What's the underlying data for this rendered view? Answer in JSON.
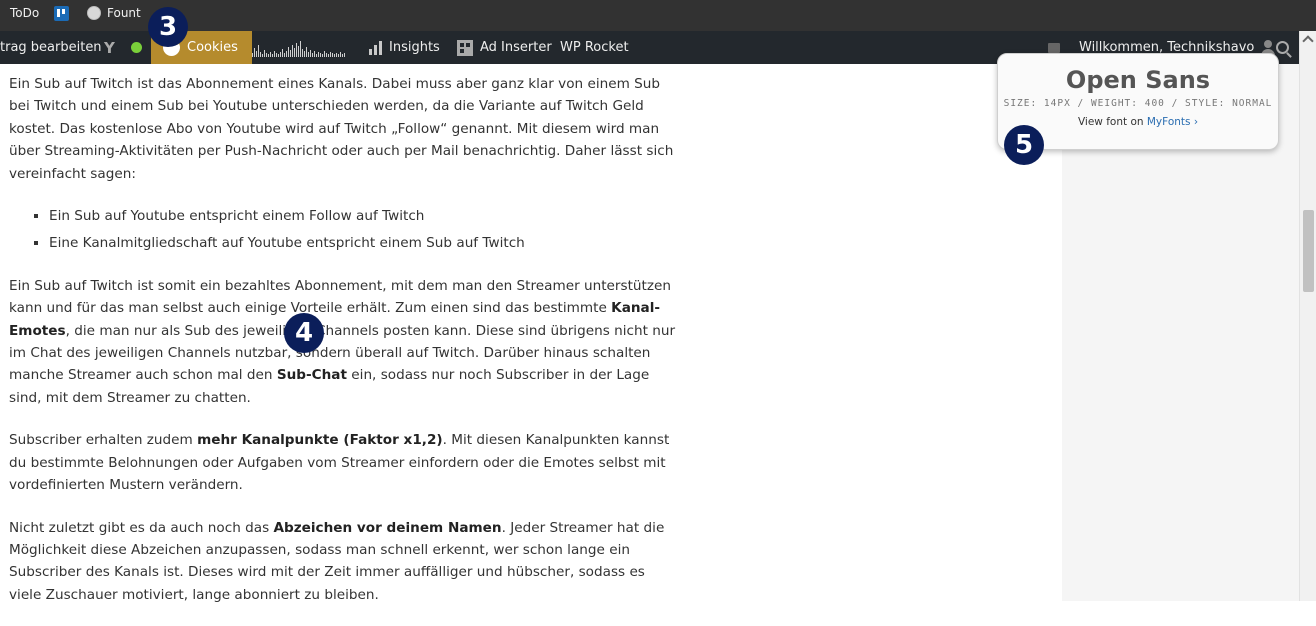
{
  "bookmarks": [
    {
      "label": "ToDo",
      "icon": "none"
    },
    {
      "label": "",
      "icon": "trello-icon"
    },
    {
      "label": "Fount",
      "icon": "globe-icon"
    }
  ],
  "adminbar": {
    "edit_post": "trag bearbeiten",
    "cookies": "Cookies",
    "insights": "Insights",
    "ad_inserter": "Ad Inserter",
    "wp_rocket": "WP Rocket",
    "welcome": "Willkommen, Technikshavo",
    "status_color": "#7ad03a",
    "cookies_color": "#b58b2d"
  },
  "article": {
    "p1": "Ein Sub auf Twitch ist das Abonnement eines Kanals. Dabei muss aber ganz klar von einem Sub bei Twitch und einem Sub bei Youtube unterschieden werden, da die Variante auf Twitch Geld kostet. Das kostenlose Abo von Youtube wird auf Twitch „Follow“ genannt. Mit diesem wird man über Streaming-Aktivitäten per Push-Nachricht oder auch per Mail benachrichtig. Daher lässt sich vereinfacht sagen:",
    "list": [
      "Ein Sub auf Youtube entspricht einem Follow auf Twitch",
      "Eine Kanalmitgliedschaft auf Youtube entspricht einem Sub auf Twitch"
    ],
    "p2_a": "Ein Sub auf Twitch ist somit ein bezahltes Abonnement, mit dem man den Streamer unterstützen kann und für das man selbst auch einige Vorteile erhält. Zum einen sind das bestimmte ",
    "p2_b1": "Kanal-Emotes",
    "p2_c": ", die man nur als Sub des jeweiligen Channels posten kann. Diese sind übrigens nicht nur im Chat des jeweiligen Channels nutzbar, sondern überall auf Twitch. Darüber hinaus schalten manche Streamer auch schon mal den ",
    "p2_b2": "Sub-Chat",
    "p2_d": " ein, sodass nur noch Subscriber in der Lage sind, mit dem Streamer zu chatten.",
    "p3_a": "Subscriber erhalten zudem ",
    "p3_b": "mehr Kanalpunkte (Faktor x1,2)",
    "p3_c": ". Mit diesen Kanalpunkten kannst du bestimmte Belohnungen oder Aufgaben vom Streamer einfordern oder die Emotes selbst mit vordefinierten Mustern verändern.",
    "p4_a": "Nicht zuletzt gibt es da auch noch das ",
    "p4_b": "Abzeichen vor deinem Namen",
    "p4_c": ". Jeder Streamer hat die Möglichkeit diese Abzeichen anzupassen, sodass man schnell erkennt, wer schon lange ein Subscriber des Kanals ist. Dieses wird mit der Zeit immer auffälliger und hübscher, sodass es viele Zuschauer motiviert, lange abonniert zu bleiben."
  },
  "font_popup": {
    "name": "Open Sans",
    "meta": "SIZE: 14PX / WEIGHT: 400 / STYLE: NORMAL",
    "link_prefix": "View font on ",
    "link_label": "MyFonts ›"
  },
  "badges": {
    "b3": "3",
    "b4": "4",
    "b5": "5",
    "color": "#0b1e5a"
  }
}
